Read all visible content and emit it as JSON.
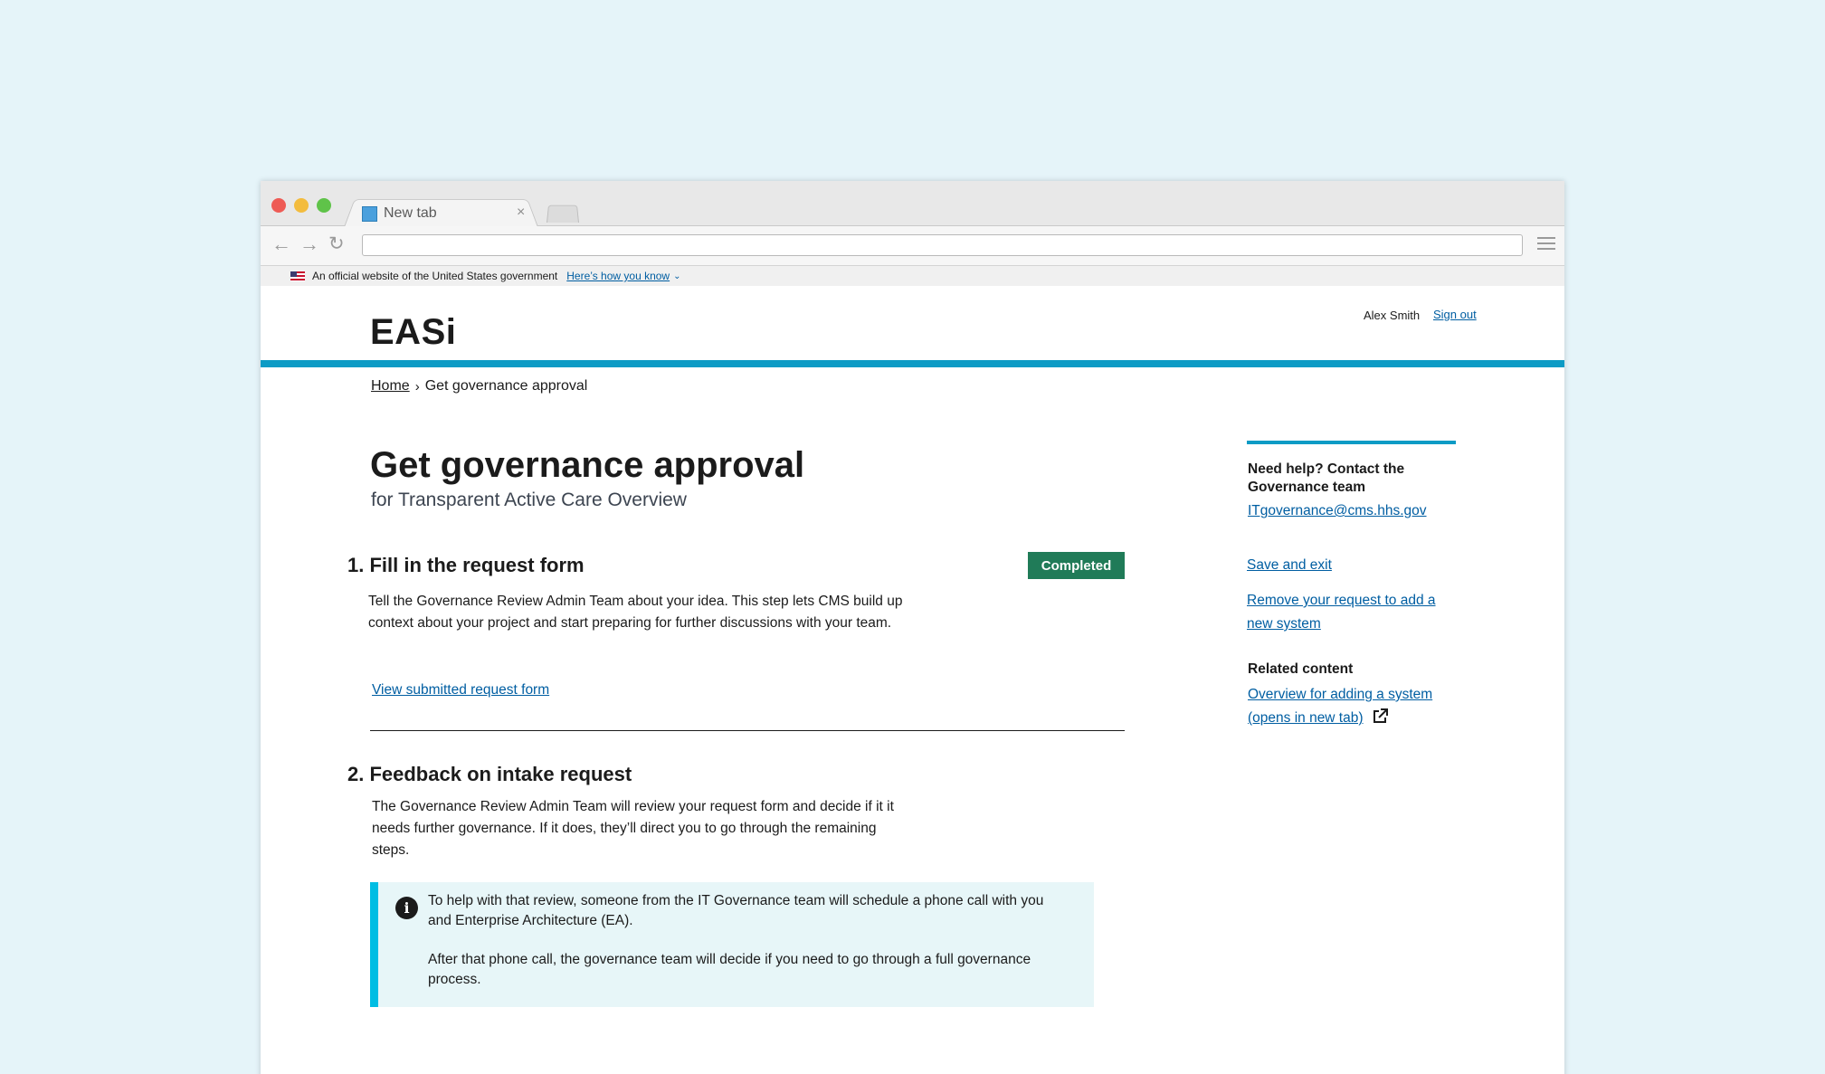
{
  "browser": {
    "tab_title": "New tab",
    "tab_close": "×",
    "back_icon": "←",
    "forward_icon": "→",
    "reload_icon": "↻"
  },
  "gov_banner": {
    "text": "An official website of the United States government",
    "link": "Here’s how you know",
    "chevron": "⌄"
  },
  "header": {
    "logo": "EASi",
    "user_name": "Alex Smith",
    "sign_out": "Sign out",
    "accent_color": "#0c9bc5"
  },
  "breadcrumb": {
    "home": "Home",
    "separator": "›",
    "current": "Get governance approval"
  },
  "main": {
    "title": "Get governance approval",
    "subtitle": "for Transparent Active Care Overview",
    "steps": [
      {
        "title": "1. Fill in the request form",
        "badge": "Completed",
        "badge_color": "#207b58",
        "description": "Tell the Governance Review Admin Team about your idea. This step lets CMS build up context about your project and start preparing for further discussions with your team.",
        "link": "View submitted request form"
      },
      {
        "title": "2. Feedback on intake request",
        "description": "The Governance Review Admin Team will review your request form and decide if it it needs further governance. If it does, they’ll direct you to go through the remaining steps.",
        "alert": {
          "icon": "i",
          "paragraph_1": "To help with that review, someone from the IT Governance team will schedule a phone call with you and Enterprise Architecture (EA).",
          "paragraph_2": "After that phone call, the governance team will decide if you need to go through a full governance process."
        }
      }
    ]
  },
  "sidebar": {
    "help_heading": "Need help? Contact the Governance team",
    "email": "ITgovernance@cms.hhs.gov",
    "save_exit": "Save and exit",
    "remove_request": "Remove your request to add a new system",
    "related_heading": "Related content",
    "overview_link": "Overview for adding a system (opens in new tab)"
  }
}
